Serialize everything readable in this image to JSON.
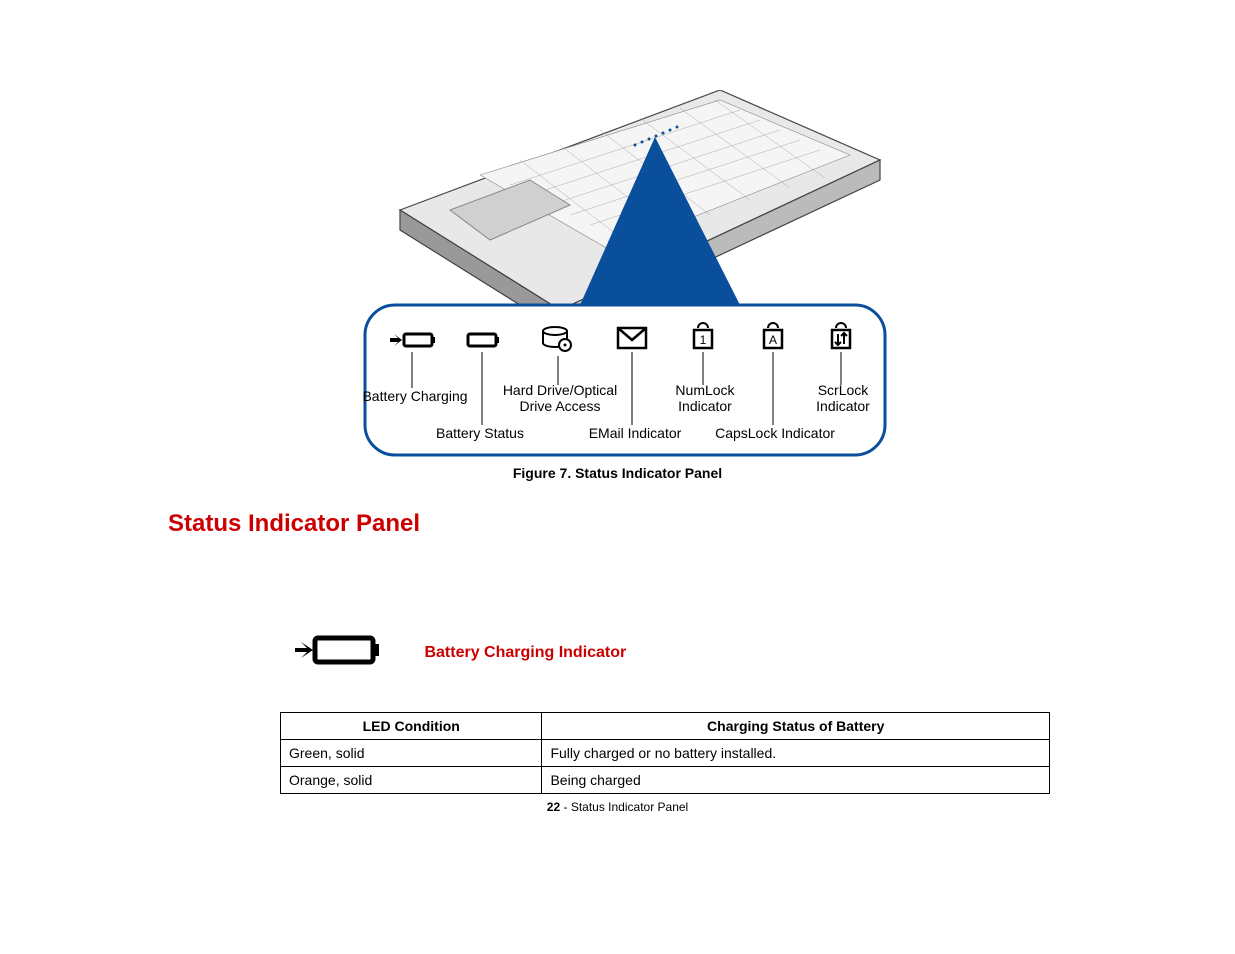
{
  "figure": {
    "caption": "Figure 7.  Status Indicator Panel",
    "callouts": {
      "batteryCharging": "Battery Charging",
      "batteryStatus": "Battery Status",
      "hardDrive": "Hard Drive/Optical Drive Access",
      "email": "EMail Indicator",
      "numlock": "NumLock Indicator",
      "capslock": "CapsLock Indicator",
      "scrlock": "ScrLock Indicator"
    }
  },
  "section": {
    "title": "Status Indicator Panel"
  },
  "subsection": {
    "title": "Battery Charging Indicator"
  },
  "table": {
    "headers": [
      "LED Condition",
      "Charging Status of Battery"
    ],
    "rows": [
      [
        "Green, solid",
        "Fully charged or no battery installed."
      ],
      [
        "Orange, solid",
        "Being charged"
      ]
    ]
  },
  "footer": {
    "page": "22",
    "sep": " - ",
    "label": "Status Indicator Panel"
  }
}
